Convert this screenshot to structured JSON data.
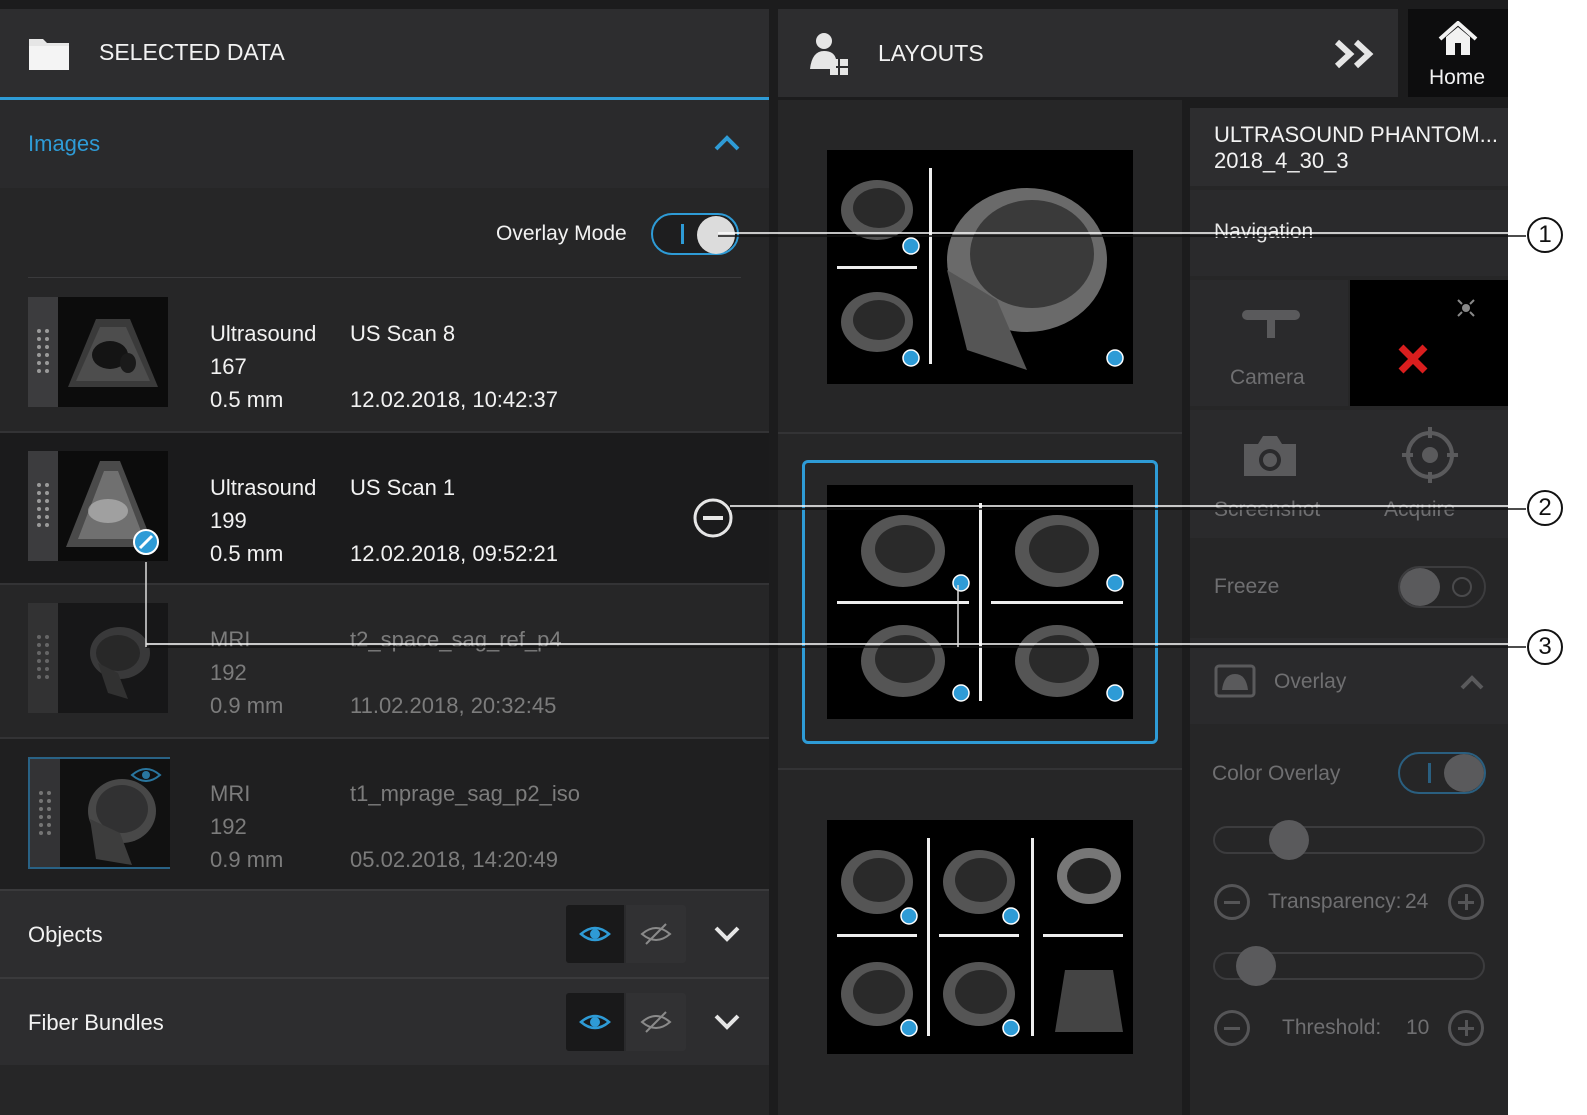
{
  "selected_data": {
    "title": "SELECTED DATA"
  },
  "images": {
    "title": "Images",
    "overlay_mode_label": "Overlay Mode",
    "rows": [
      {
        "modality": "Ultrasound",
        "slices": "167",
        "spacing": "0.5 mm",
        "name": "US Scan 8",
        "datetime": "12.02.2018, 10:42:37"
      },
      {
        "modality": "Ultrasound",
        "slices": "199",
        "spacing": "0.5 mm",
        "name": "US Scan 1",
        "datetime": "12.02.2018, 09:52:21"
      },
      {
        "modality": "MRI",
        "slices": "192",
        "spacing": "0.9 mm",
        "name": "t2_space_sag_ref_p4",
        "datetime": "11.02.2018, 20:32:45"
      },
      {
        "modality": "MRI",
        "slices": "192",
        "spacing": "0.9 mm",
        "name": "t1_mprage_sag_p2_iso",
        "datetime": "05.02.2018, 14:20:49"
      }
    ]
  },
  "objects": {
    "title": "Objects"
  },
  "fiber_bundles": {
    "title": "Fiber Bundles"
  },
  "layouts": {
    "title": "LAYOUTS"
  },
  "home": {
    "label": "Home"
  },
  "right_panel": {
    "title_line1": "ULTRASOUND PHANTOM...",
    "title_line2": "2018_4_30_3",
    "navigation": "Navigation",
    "camera": "Camera",
    "screenshot": "Screenshot",
    "acquire": "Acquire",
    "freeze": "Freeze",
    "overlay": "Overlay",
    "color_overlay": "Color Overlay",
    "transparency_label": "Transparency:",
    "transparency_value": "24",
    "threshold_label": "Threshold:",
    "threshold_value": "10"
  },
  "callouts": [
    "1",
    "2",
    "3"
  ],
  "colors": {
    "accent": "#2e9bd6",
    "background": "#1c1c1d",
    "marker_red": "#d91e1e"
  }
}
